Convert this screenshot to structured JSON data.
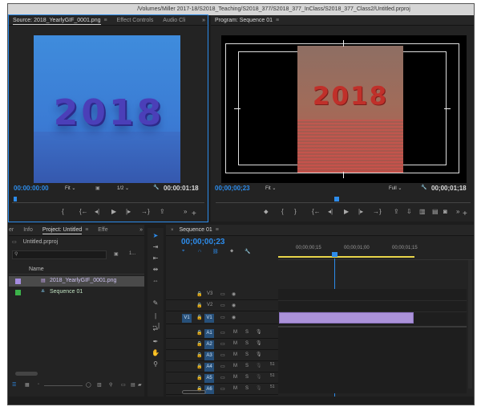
{
  "window": {
    "title": "/Volumes/Miller 2017-18/S2018_Teaching/S2018_377/S2018_377_InClass/S2018_377_Class2/Untitled.prproj"
  },
  "source": {
    "tabs": [
      "Source: 2018_YearlyGIF_0001.png",
      "Effect Controls",
      "Audio Cli"
    ],
    "timecode": "00:00:00:00",
    "fit": "Fit",
    "resolution": "1/2",
    "duration": "00:00:01:18",
    "image_text": "2018"
  },
  "program": {
    "tab": "Program: Sequence 01",
    "timecode": "00;00;00;23",
    "fit": "Fit",
    "quality": "Full",
    "duration": "00;00;01;18",
    "image_text": "2018"
  },
  "project": {
    "tabs": [
      "er",
      "Info",
      "Project: Untitled",
      "Effe"
    ],
    "file": "Untitled.prproj",
    "column_name": "Name",
    "items_count": "1...",
    "items": [
      {
        "name": "2018_YearlyGIF_0001.png",
        "color": "#a58ce0"
      },
      {
        "name": "Sequence 01",
        "color": "#3cb34a"
      }
    ]
  },
  "timeline": {
    "tab": "Sequence 01",
    "timecode": "00;00;00;23",
    "ruler": [
      "00;00;00;15",
      "00;00;01;00",
      "00;00;01;15"
    ],
    "video_tracks": [
      "V3",
      "V2",
      "V1"
    ],
    "audio_tracks": [
      "A1",
      "A2",
      "A3",
      "A4",
      "A5",
      "A6"
    ],
    "source_patch_v": "V1",
    "track_ctl": {
      "mute": "M",
      "solo": "S"
    },
    "audio_extra": "51",
    "clip_color": "#ab92d9"
  },
  "colors": {
    "accent": "#2d8ceb",
    "clip": "#ab92d9",
    "program_red": "#c0302a"
  }
}
